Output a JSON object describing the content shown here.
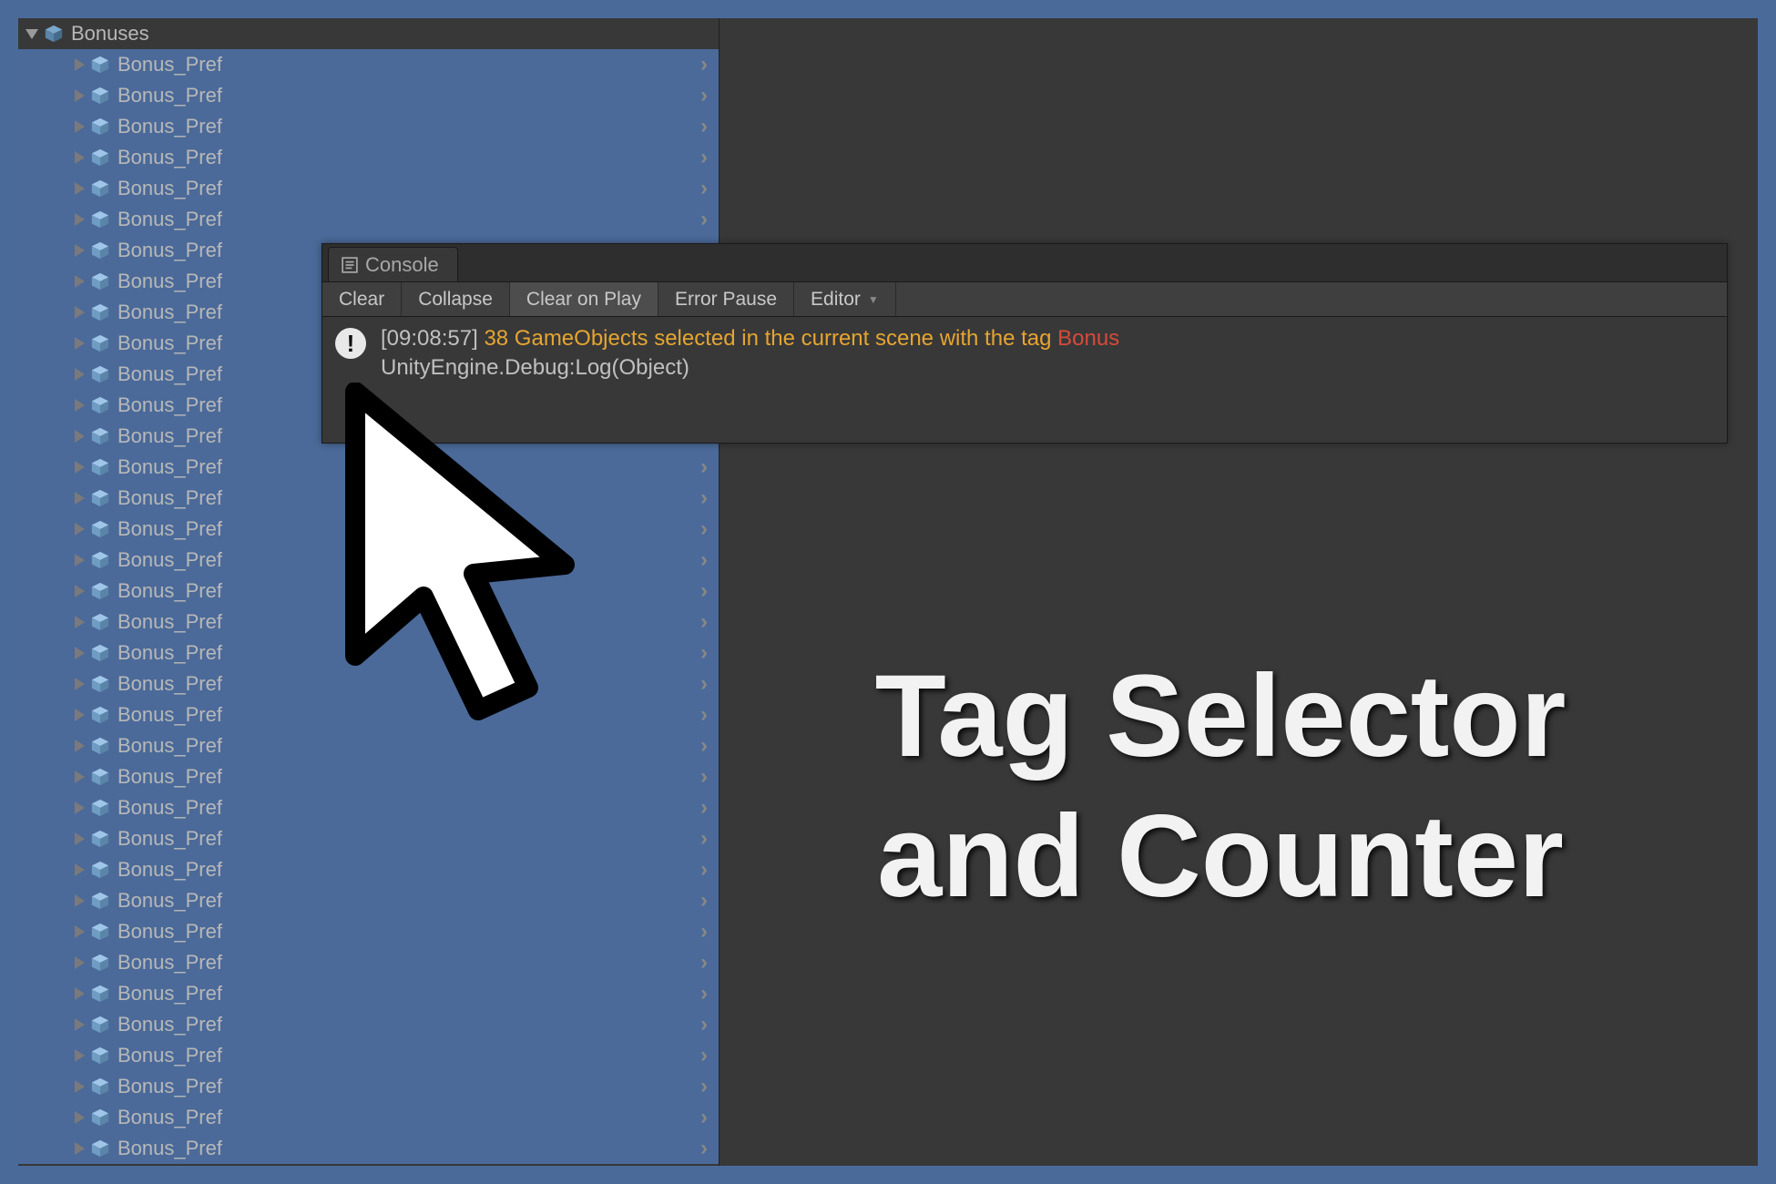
{
  "hierarchy": {
    "parent_label": "Bonuses",
    "child_label": "Bonus_Pref",
    "child_count": 36
  },
  "console": {
    "tab_label": "Console",
    "toolbar": {
      "clear": "Clear",
      "collapse": "Collapse",
      "clear_on_play": "Clear on Play",
      "error_pause": "Error Pause",
      "editor": "Editor"
    },
    "log": {
      "timestamp": "[09:08:57]",
      "message_prefix": "38 GameObjects selected in the current scene with the tag ",
      "tag": "Bonus",
      "subline": "UnityEngine.Debug:Log(Object)"
    }
  },
  "title": {
    "line1": "Tag Selector",
    "line2": "and Counter"
  },
  "icons": {
    "cube": "cube-icon",
    "info": "!"
  }
}
